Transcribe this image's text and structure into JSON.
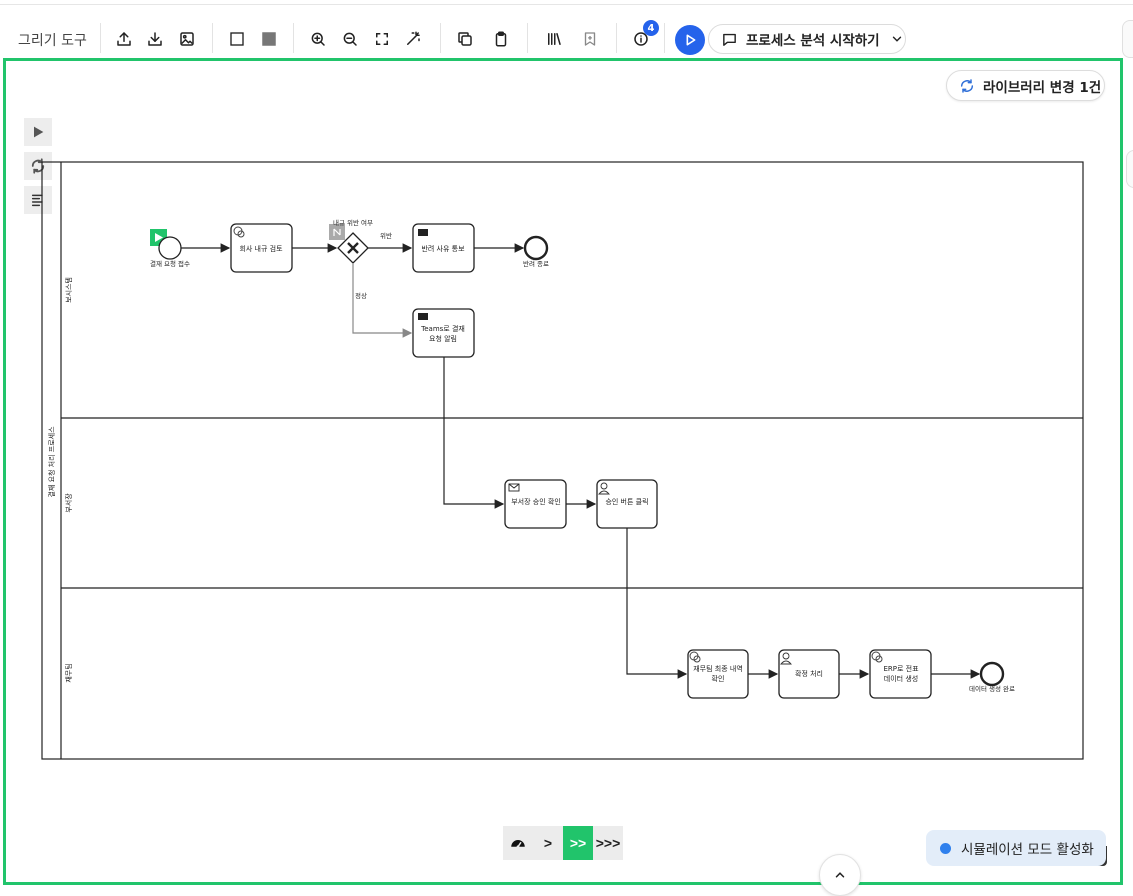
{
  "toolbar": {
    "drawing_tools_label": "그리기 도구",
    "issues_badge_count": "4",
    "analyze_label": "프로세스 분석 시작하기",
    "icons": [
      "upload-icon",
      "download-icon",
      "image-icon",
      "outline-square-icon",
      "filled-square-icon",
      "zoom-in-icon",
      "zoom-out-icon",
      "fit-screen-icon",
      "magic-wand-icon",
      "copy-icon",
      "paste-icon",
      "library-icon",
      "bookmark-icon",
      "info-icon",
      "play-icon",
      "comment-icon",
      "chevron-down-icon"
    ]
  },
  "library_change_label": "라이브러리 변경 1건",
  "side_tools": [
    "play-icon",
    "refresh-icon",
    "list-icon"
  ],
  "diagram": {
    "pool_label": "결재 요청 처리 프로세스",
    "lanes": [
      "보시스템",
      "부서장",
      "재무팀"
    ],
    "nodes": {
      "start": "결재 요청 접수",
      "task1": "회사 내규 검토",
      "gateway": "내규 위반 여부",
      "flow_violation": "위반",
      "flow_normal": "정상",
      "task_reject_line1": "반려 사유 통보",
      "end_reject": "반려 종료",
      "task_teams_line1": "Teams로 결재",
      "task_teams_line2": "요청 알림",
      "task_head_confirm": "부서장 승인 확인",
      "task_approve_click": "승인 버튼 클릭",
      "task_finance_line1": "재무팀 최종 내역",
      "task_finance_line2": "확인",
      "task_settle": "확정 처리",
      "task_erp_line1": "ERP로 전표",
      "task_erp_line2": "데이터 생성",
      "end_data": "데이터 생성 완료"
    }
  },
  "speed_controls": [
    "gauge-icon",
    ">",
    ">>",
    ">>>"
  ],
  "simulation_label": "시뮬레이션 모드 활성화",
  "colors": {
    "accent_green": "#21c46b",
    "accent_blue": "#2563eb",
    "sim_dot": "#2f80ed"
  }
}
